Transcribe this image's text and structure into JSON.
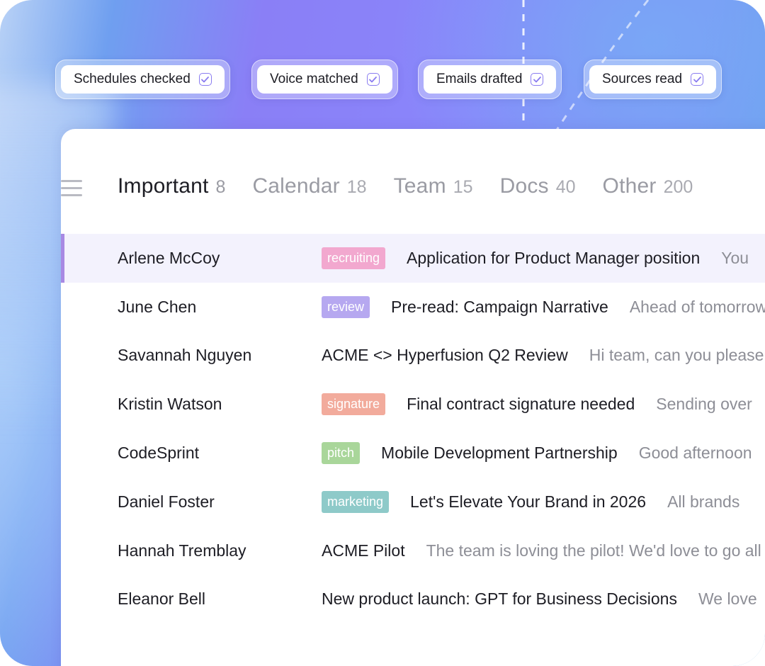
{
  "colors": {
    "accent": "#a889e3",
    "check": "#8a7cf0",
    "selected_row": "#f3f2fd"
  },
  "chips": [
    {
      "label": "Schedules checked",
      "icon": "checkbox-checked-icon"
    },
    {
      "label": "Voice matched",
      "icon": "checkbox-checked-icon"
    },
    {
      "label": "Emails drafted",
      "icon": "checkbox-checked-icon"
    },
    {
      "label": "Sources read",
      "icon": "checkbox-checked-icon"
    }
  ],
  "nav": {
    "menu_icon": "hamburger-menu-icon"
  },
  "tabs": [
    {
      "label": "Important",
      "count": "8",
      "active": true
    },
    {
      "label": "Calendar",
      "count": "18"
    },
    {
      "label": "Team",
      "count": "15"
    },
    {
      "label": "Docs",
      "count": "40"
    },
    {
      "label": "Other",
      "count": "200"
    }
  ],
  "emails": [
    {
      "sender": "Arlene McCoy",
      "tag": "recruiting",
      "tag_color": "#f2a8cf",
      "subject": "Application for Product Manager position",
      "preview": "You",
      "selected": true
    },
    {
      "sender": "June Chen",
      "tag": "review",
      "tag_color": "#b6a8f0",
      "subject": "Pre-read: Campaign Narrative",
      "preview": "Ahead of tomorrow"
    },
    {
      "sender": "Savannah Nguyen",
      "tag": "",
      "tag_color": "",
      "subject": "ACME <> Hyperfusion Q2 Review",
      "preview": "Hi team, can you please"
    },
    {
      "sender": "Kristin Watson",
      "tag": "signature",
      "tag_color": "#f2ab9c",
      "subject": "Final contract signature needed",
      "preview": "Sending over"
    },
    {
      "sender": "CodeSprint",
      "tag": "pitch",
      "tag_color": "#a9d69a",
      "subject": "Mobile Development Partnership",
      "preview": "Good afternoon"
    },
    {
      "sender": "Daniel Foster",
      "tag": "marketing",
      "tag_color": "#8ecac9",
      "subject": "Let's Elevate Your Brand in 2026",
      "preview": "All brands"
    },
    {
      "sender": "Hannah Tremblay",
      "tag": "",
      "tag_color": "",
      "subject": "ACME Pilot",
      "preview": "The team is loving the pilot! We'd love to go all"
    },
    {
      "sender": "Eleanor Bell",
      "tag": "",
      "tag_color": "",
      "subject": "New product launch: GPT for Business Decisions",
      "preview": "We love"
    }
  ]
}
